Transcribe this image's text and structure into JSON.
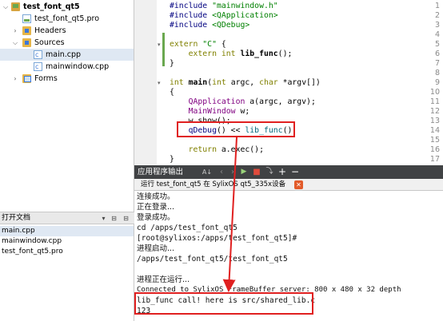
{
  "project_tree": {
    "project": "test_font_qt5",
    "pro_file": "test_font_qt5.pro",
    "headers": "Headers",
    "sources": "Sources",
    "main_cpp": "main.cpp",
    "mainwindow_cpp": "mainwindow.cpp",
    "forms": "Forms"
  },
  "open_documents": {
    "title": "打开文档",
    "items": [
      "main.cpp",
      "mainwindow.cpp",
      "test_font_qt5.pro"
    ]
  },
  "editor": {
    "line_numbers": [
      "1",
      "2",
      "3",
      "4",
      "5",
      "6",
      "7",
      "8",
      "9",
      "10",
      "11",
      "12",
      "13",
      "14",
      "15",
      "16",
      "17"
    ],
    "lines": {
      "l1_directive": "#include",
      "l1_file": " \"mainwindow.h\"",
      "l2_directive": "#include",
      "l2_file": " <QApplication>",
      "l3_directive": "#include",
      "l3_file": " <QDebug>",
      "l5_kw": "extern",
      "l5_str": " \"C\"",
      "l5_rest": " {",
      "l6_kw": "    extern int",
      "l6_fn": " lib_func",
      "l6_rest": "();",
      "l7": "}",
      "l9_kw": "int",
      "l9_fn": " main",
      "l9_rest1": "(",
      "l9_kw2": "int",
      "l9_rest2": " argc, ",
      "l9_kw3": "char",
      "l9_rest3": " *argv[])",
      "l10": "{",
      "l11_cls": "    QApplication",
      "l11_rest": " a(argc, argv);",
      "l12_cls": "    MainWindow",
      "l12_rest": " w;",
      "l13": "    w.show();",
      "l14_macro": "    qDebug",
      "l14_rest": "() << ",
      "l14_fn": "lib_func",
      "l14_end": "();",
      "l16_kw": "    return",
      "l16_rest": " a.exec();",
      "l17": "}"
    }
  },
  "output_pane": {
    "title": "应用程序输出",
    "toolbar_icons": [
      "filter-icon",
      "prev-icon",
      "next-icon",
      "run-icon",
      "stop-icon",
      "attach-icon",
      "plus-icon",
      "minus-icon"
    ],
    "toolbar_glyphs": {
      "filter": "A↓",
      "prev": "‹",
      "next": "›",
      "run": "▶",
      "stop": "■",
      "attach": "⤵",
      "plus": "+",
      "minus": "−"
    },
    "run_tab": "运行 test_font_qt5 在 SylixOS qt5_335x设备",
    "close_glyph": "✕",
    "lines": [
      "连接成功。",
      "正在登录...",
      "登录成功。",
      "cd /apps/test_font_qt5",
      "[root@sylixos:/apps/test_font_qt5]#",
      "进程启动...",
      "/apps/test_font_qt5/test_font_qt5",
      "",
      "进程正在运行...",
      "Connected to SylixOS FrameBuffer server: 800 x 480 x 32 depth",
      "lib_func call! here is src/shared_lib.c",
      "123"
    ]
  },
  "colors": {
    "annotation_red": "#e02020",
    "toolbar_dark": "#404244",
    "selection": "#dfe8f3"
  }
}
